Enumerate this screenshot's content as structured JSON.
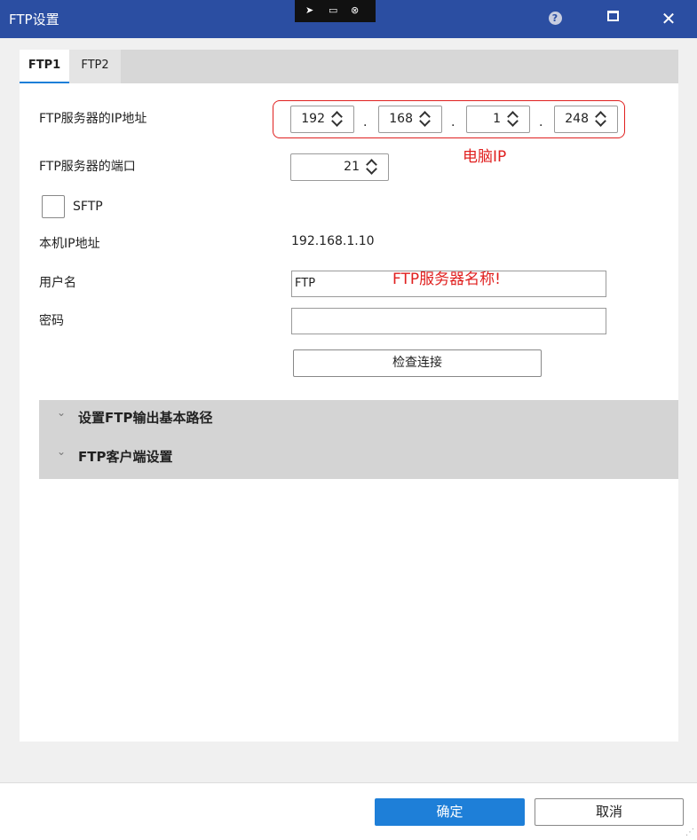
{
  "window": {
    "title": "FTP设置",
    "help_glyph": "?"
  },
  "tabs": [
    {
      "label": "FTP1",
      "active": true
    },
    {
      "label": "FTP2",
      "active": false
    }
  ],
  "server_ip": {
    "label": "FTP服务器的IP地址",
    "octets": [
      "192",
      "168",
      "1",
      "248"
    ],
    "separator": "."
  },
  "server_port": {
    "label": "FTP服务器的端口",
    "value": "21"
  },
  "sftp": {
    "label": "SFTP",
    "checked": false
  },
  "local_ip": {
    "label": "本机IP地址",
    "value": "192.168.1.10"
  },
  "username": {
    "label": "用户名",
    "value": "FTP"
  },
  "password": {
    "label": "密码",
    "value": ""
  },
  "check_connection_label": "检查连接",
  "sections": [
    {
      "title": "设置FTP输出基本路径"
    },
    {
      "title": "FTP客户端设置"
    }
  ],
  "annotations": {
    "ip_note": "电脑IP",
    "username_note": "FTP服务器名称!"
  },
  "footer": {
    "ok_label": "确定",
    "cancel_label": "取消"
  },
  "colors": {
    "titlebar": "#2b4ea2",
    "primary_button": "#1e7fd8",
    "annotation": "#e0201f"
  }
}
